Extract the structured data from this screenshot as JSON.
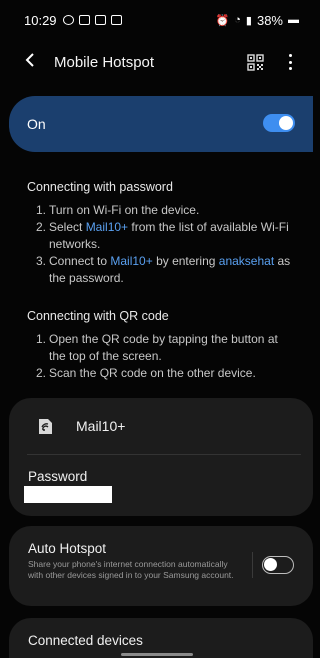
{
  "status_bar": {
    "time": "10:29",
    "battery": "38%"
  },
  "app_bar": {
    "title": "Mobile Hotspot",
    "back_icon": "back-arrow-icon",
    "qr_icon": "qr-code-icon",
    "more_icon": "more-options-icon"
  },
  "master_switch": {
    "label": "On",
    "state": true
  },
  "help_password": {
    "heading": "Connecting with password",
    "step1_num": "1.",
    "step1": "Turn on Wi-Fi on the device.",
    "step2_num": "2.",
    "step2_pre": "Select ",
    "step2_link": "Mail10+",
    "step2_post": " from the list of available Wi-Fi networks.",
    "step3_num": "3.",
    "step3_pre": "Connect to ",
    "step3_link": "Mail10+",
    "step3_mid": " by entering ",
    "step3_link2": "anaksehat",
    "step3_post": " as the password."
  },
  "help_qr": {
    "heading": "Connecting with QR code",
    "step1_num": "1.",
    "step1": "Open the QR code by tapping the button at the top of the screen.",
    "step2_num": "2.",
    "step2": "Scan the QR code on the other device."
  },
  "network": {
    "name": "Mail10+",
    "password_label": "Password",
    "icon": "hotspot-network-icon"
  },
  "auto_hotspot": {
    "title": "Auto Hotspot",
    "description": "Share your phone's internet connection automatically with other devices signed in to your Samsung account.",
    "state": false
  },
  "connected_devices": {
    "title": "Connected devices"
  },
  "colors": {
    "accent": "#3e8ef0",
    "card_on": "#1b3f6e",
    "link": "#5aa0f0",
    "background": "#050505"
  }
}
